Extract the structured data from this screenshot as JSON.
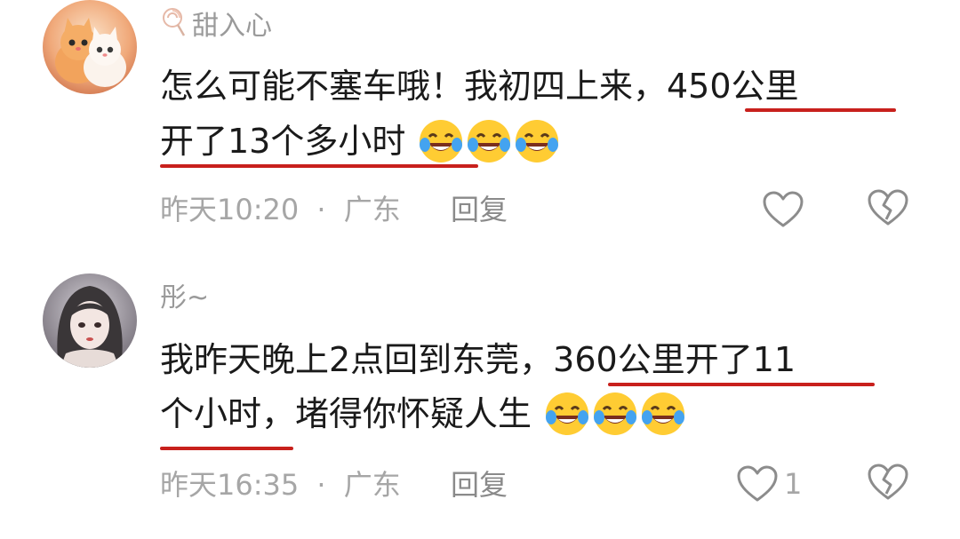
{
  "comments": [
    {
      "username": "甜入心",
      "username_icon": "lollipop-icon",
      "lines": [
        {
          "text": "怎么可能不塞车哦！我初四上来，450公里"
        },
        {
          "text": "开了13个多小时"
        }
      ],
      "emojis": [
        "laugh-cry-emoji",
        "laugh-cry-emoji",
        "laugh-cry-emoji"
      ],
      "time": "昨天10:20",
      "separator": "·",
      "location": "广东",
      "reply_label": "回复",
      "like_count": "",
      "avatar": "kittens-avatar"
    },
    {
      "username": "彤~",
      "lines": [
        {
          "text": "我昨天晚上2点回到东莞，360公里开了11"
        },
        {
          "text": "个小时，堵得你怀疑人生"
        }
      ],
      "emojis": [
        "laugh-cry-emoji",
        "laugh-cry-emoji",
        "laugh-cry-emoji"
      ],
      "time": "昨天16:35",
      "separator": "·",
      "location": "广东",
      "reply_label": "回复",
      "like_count": "1",
      "avatar": "anime-girl-avatar"
    }
  ],
  "colors": {
    "underline": "#c8201c",
    "meta": "#a6a6a6",
    "text": "#1a1a1a"
  }
}
